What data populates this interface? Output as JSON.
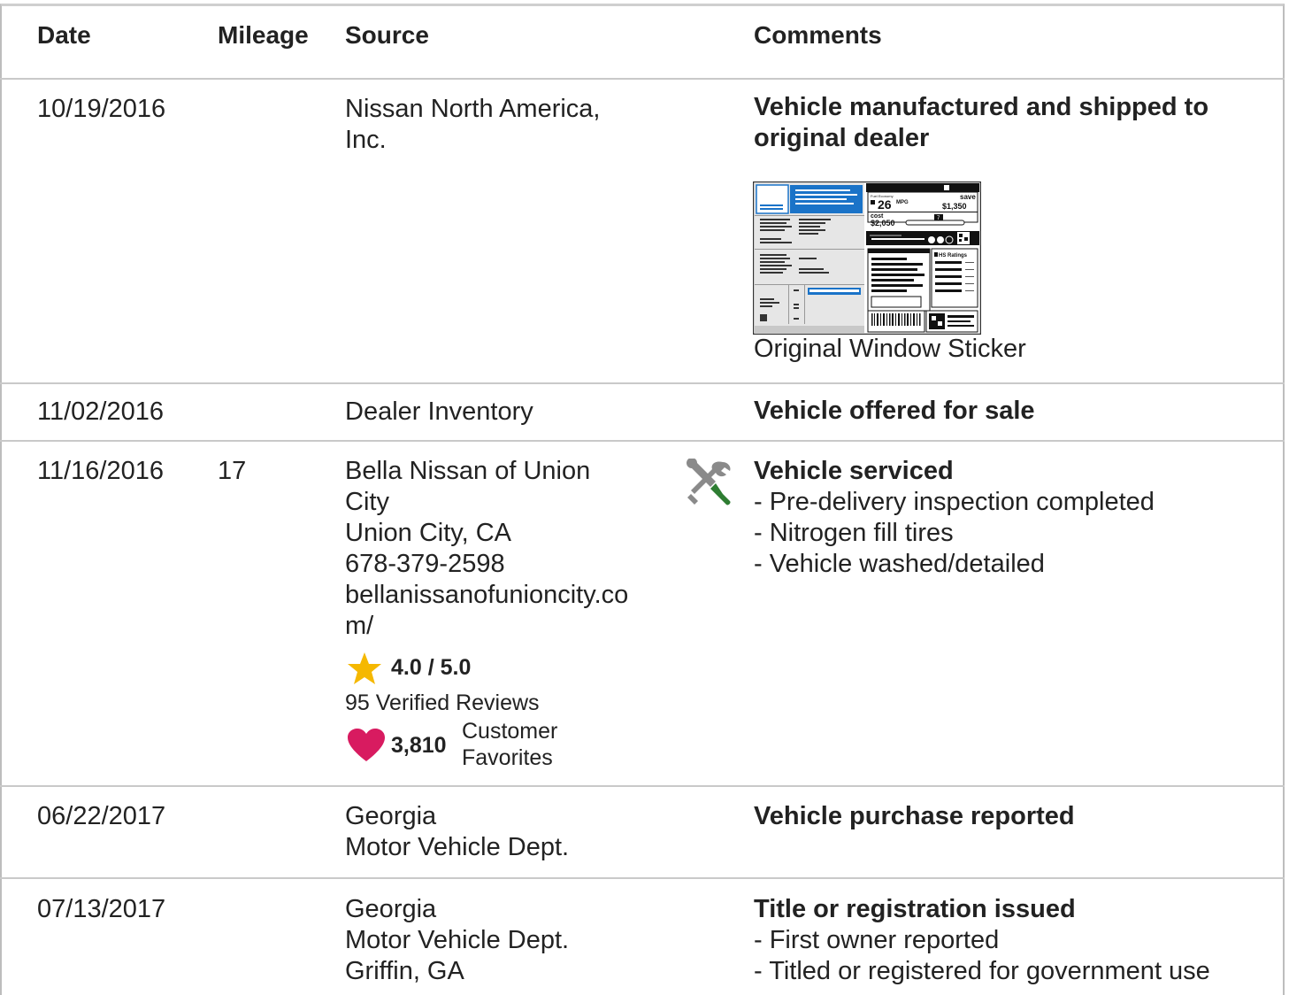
{
  "headers": {
    "date": "Date",
    "mileage": "Mileage",
    "source": "Source",
    "comments": "Comments"
  },
  "rows": [
    {
      "date": "10/19/2016",
      "mileage": "",
      "source": [
        "Nissan North America,",
        "Inc."
      ],
      "comment_title": [
        "Vehicle manufactured and shipped to",
        "original dealer"
      ],
      "attachment": {
        "label": "Original Window Sticker",
        "sticker": {
          "fuel_economy_label": "Fuel Economy",
          "mpg_value": "26",
          "mpg_unit": "MPG",
          "save_label": "save",
          "save_value": "$1,350",
          "cost_label": "cost",
          "cost_value": "$2,050",
          "slider_value": "7",
          "ratings_label": "HS Ratings"
        }
      }
    },
    {
      "date": "11/02/2016",
      "mileage": "",
      "source": [
        "Dealer Inventory"
      ],
      "comment_title": [
        "Vehicle offered for sale"
      ]
    },
    {
      "date": "11/16/2016",
      "mileage": "17",
      "source": [
        "Bella Nissan of Union",
        "City",
        "Union City, CA",
        "678-379-2598",
        "bellanissanofunioncity.co",
        "m/"
      ],
      "rating": "4.0 / 5.0",
      "reviews": "95 Verified Reviews",
      "favorites_count": "3,810",
      "favorites_label": [
        "Customer",
        "Favorites"
      ],
      "icon": "service-tools-icon",
      "comment_title": [
        "Vehicle serviced"
      ],
      "comment_items": [
        "Pre-delivery inspection completed",
        "Nitrogen fill tires",
        "Vehicle washed/detailed"
      ]
    },
    {
      "date": "06/22/2017",
      "mileage": "",
      "source": [
        "Georgia",
        "Motor Vehicle Dept."
      ],
      "comment_title": [
        "Vehicle purchase reported"
      ]
    },
    {
      "date": "07/13/2017",
      "mileage": "",
      "source": [
        "Georgia",
        "Motor Vehicle Dept.",
        "Griffin, GA"
      ],
      "comment_title": [
        "Title or registration issued"
      ],
      "comment_items": [
        "First owner reported",
        "Titled or registered for government use"
      ]
    }
  ],
  "colors": {
    "star": "#f5b800",
    "heart": "#d81b60",
    "wrench": "#8a8a8a",
    "screwdriver": "#2e7d32",
    "sticker_blue": "#1a73c8",
    "divider": "#c9c9c9"
  }
}
